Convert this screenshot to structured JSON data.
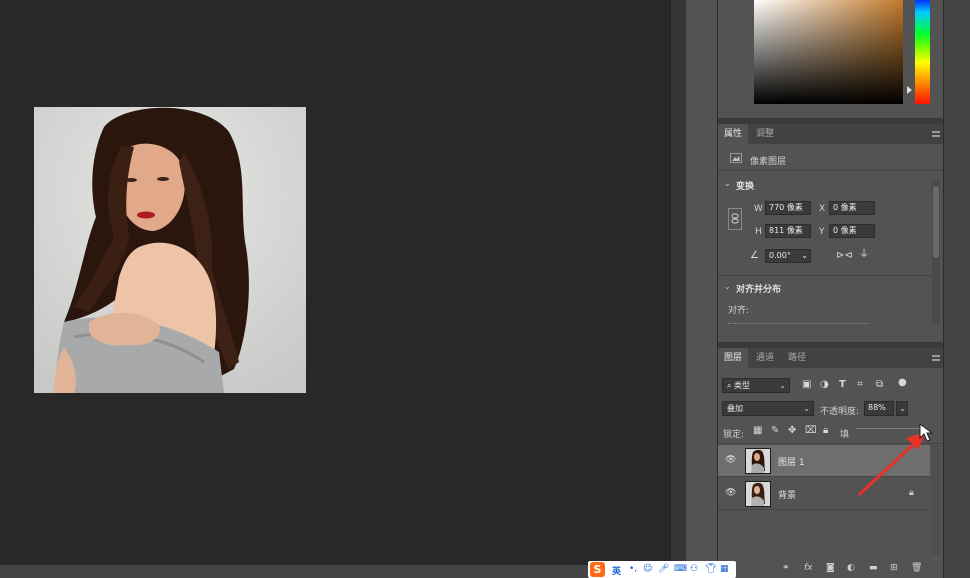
{
  "properties_panel": {
    "tabs": [
      "属性",
      "调整"
    ],
    "layer_kind": "像素图层",
    "section_transform": "变换",
    "w_label": "W",
    "w_value": "770 像素",
    "x_label": "X",
    "x_value": "0 像素",
    "h_label": "H",
    "h_value": "811 像素",
    "y_label": "Y",
    "y_value": "0 像素",
    "angle_value": "0.00°",
    "section_align": "对齐并分布",
    "align_label": "对齐:"
  },
  "layers_panel": {
    "tabs": [
      "图层",
      "通道",
      "路径"
    ],
    "filter_kind": "类型",
    "blend_mode": "叠加",
    "opacity_label": "不透明度:",
    "opacity_value": "88%",
    "lock_label": "锁定:",
    "fill_label": "填",
    "layers": [
      {
        "name": "图层 1",
        "selected": true,
        "visible": true,
        "locked": false
      },
      {
        "name": "背景",
        "selected": false,
        "visible": true,
        "locked": true
      }
    ]
  },
  "ime_bar": {
    "logo": "S",
    "lang": "英"
  },
  "colors": {
    "annotation_arrow": "#e8312a",
    "picker_base": "#c27a2a"
  }
}
